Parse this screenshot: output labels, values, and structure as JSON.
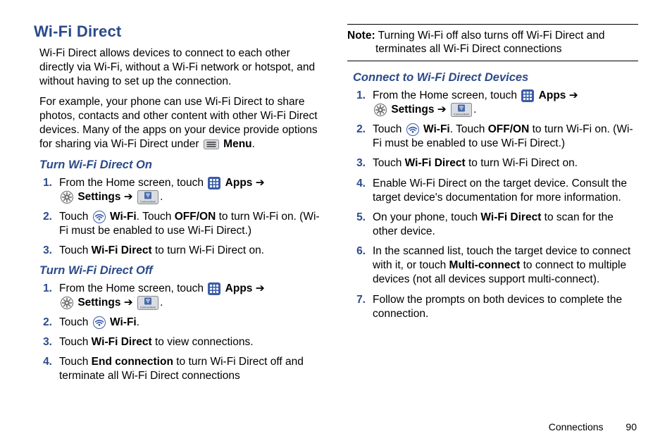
{
  "title": "Wi-Fi Direct",
  "intro1": "Wi-Fi Direct allows devices to connect to each other directly via Wi-Fi, without a Wi-Fi network or hotspot, and without having to set up the connection.",
  "intro2_a": "For example, your phone can use Wi-Fi Direct to share photos, contacts and other content with other Wi-Fi Direct devices. Many of the apps on your device provide options for sharing via Wi-Fi Direct under ",
  "intro2_menu": "Menu",
  "intro2_b": ".",
  "sec_on_title": "Turn Wi-Fi Direct On",
  "sec_off_title": "Turn Wi-Fi Direct Off",
  "sec_connect_title": "Connect to Wi-Fi Direct Devices",
  "lbl_apps": "Apps",
  "lbl_settings": "Settings",
  "lbl_wifi": "Wi-Fi",
  "lbl_wifi_direct": "Wi-Fi Direct",
  "lbl_offon": "OFF/ON",
  "lbl_end_conn": "End connection",
  "lbl_multi": "Multi-connect",
  "arrow": " ➔ ",
  "period": ".",
  "step_from_home": "From the Home screen, touch ",
  "step_touch": "Touch ",
  "step2_tail_a": ". Touch ",
  "step2_tail_b": " to turn Wi-Fi on. (Wi-Fi must be enabled to use Wi-Fi Direct.)",
  "on_step3_tail": " to turn Wi-Fi Direct on.",
  "off_step3_tail": " to view connections.",
  "off_step4_tail": " to turn Wi-Fi Direct off and terminate all Wi-Fi Direct connections",
  "note_label": "Note:",
  "note_text": " Turning Wi-Fi off also turns off Wi-Fi Direct and terminates all Wi-Fi Direct connections",
  "conn_step4": "Enable Wi-Fi Direct on the target device. Consult the target device's documentation for more information.",
  "conn_step5_a": "On your phone, touch ",
  "conn_step5_b": " to scan for the other device.",
  "conn_step6_a": "In the scanned list, touch the target device to connect with it, or touch ",
  "conn_step6_b": " to connect to multiple devices (not all devices support multi-connect).",
  "conn_step7": "Follow the prompts on both devices to complete the connection.",
  "footer_section": "Connections",
  "footer_page": "90",
  "icons": {
    "menu": "menu-icon",
    "apps": "apps-icon",
    "settings": "settings-icon",
    "wifi": "wifi-icon",
    "connections_tab": "connections-tab-icon"
  }
}
